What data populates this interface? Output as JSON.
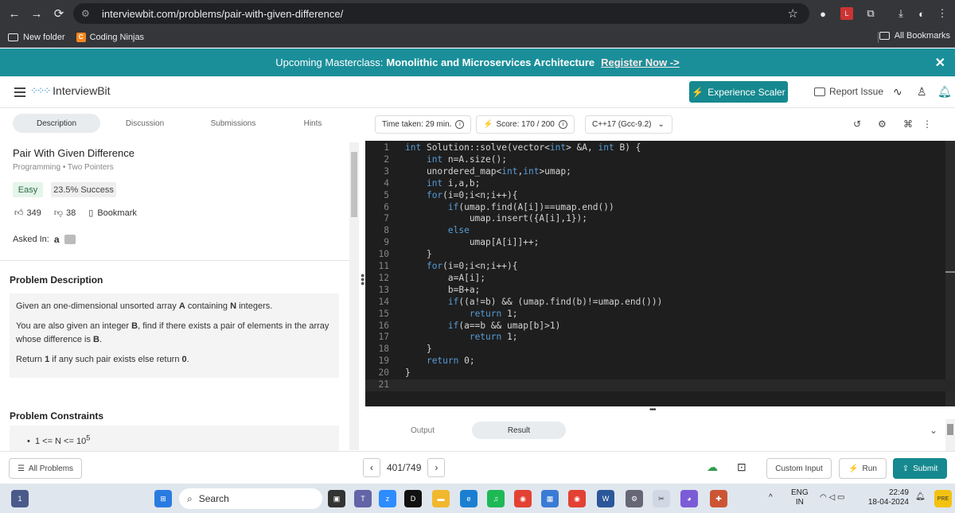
{
  "browser": {
    "url": "interviewbit.com/problems/pair-with-given-difference/",
    "bookmarks": [
      "New folder",
      "Coding Ninjas"
    ],
    "all_bookmarks": "All Bookmarks"
  },
  "banner": {
    "prefix": "Upcoming Masterclass:",
    "title": "Monolithic and Microservices Architecture",
    "link": "Register Now ->"
  },
  "header": {
    "logo": "InterviewBit",
    "experience": "Experience Scaler",
    "report": "Report Issue"
  },
  "tabs": [
    "Description",
    "Discussion",
    "Submissions",
    "Hints"
  ],
  "problem": {
    "title": "Pair With Given Difference",
    "tag1": "Programming",
    "tag2": "Two Pointers",
    "difficulty": "Easy",
    "success": "23.5% Success",
    "likes": "349",
    "dislikes": "38",
    "bookmark": "Bookmark",
    "asked_in": "Asked In:",
    "company": "a",
    "desc_heading": "Problem Description",
    "desc_p1_a": "Given an one-dimensional unsorted array",
    "desc_p1_b": "A",
    "desc_p1_c": "containing",
    "desc_p1_d": "N",
    "desc_p1_e": "integers.",
    "desc_p2_a": "You are also given an integer",
    "desc_p2_b": "B",
    "desc_p2_c": ", find if there exists a pair of elements in the array",
    "desc_p2_d": "whose difference is",
    "desc_p2_e": "B",
    "desc_p2_f": ".",
    "desc_p3_a": "Return",
    "desc_p3_b": "1",
    "desc_p3_c": "if any such pair exists else return",
    "desc_p3_d": "0",
    "desc_p3_e": ".",
    "cons_heading": "Problem Constraints",
    "cons_1": "1 <= N <= 10",
    "cons_1_sup": "5"
  },
  "toolbar": {
    "time": "Time taken: 29 min.",
    "score": "Score: 170 / 200",
    "lang": "C++17 (Gcc-9.2)"
  },
  "code_lines": [
    "int Solution::solve(vector<int> &A, int B) {",
    "    int n=A.size();",
    "    unordered_map<int,int>umap;",
    "    int i,a,b;",
    "    for(i=0;i<n;i++){",
    "        if(umap.find(A[i])==umap.end())",
    "            umap.insert({A[i],1});",
    "        else",
    "            umap[A[i]]++;",
    "    }",
    "    for(i=0;i<n;i++){",
    "        a=A[i];",
    "        b=B+a;",
    "        if((a!=b) && (umap.find(b)!=umap.end()))",
    "            return 1;",
    "        if(a==b && umap[b]>1)",
    "            return 1;",
    "    }",
    "    return 0;",
    "}",
    ""
  ],
  "output_tabs": [
    "Output",
    "Result"
  ],
  "bottom": {
    "all_problems": "All Problems",
    "page": "401/749",
    "custom_input": "Custom Input",
    "run": "Run",
    "submit": "Submit"
  },
  "taskbar": {
    "search": "Search",
    "lang1": "ENG",
    "lang2": "IN",
    "time": "22:49",
    "date": "18-04-2024"
  },
  "colors": {
    "accent": "#15898f",
    "banner": "#1a8f9a",
    "editor_bg": "#1e1e1e"
  }
}
